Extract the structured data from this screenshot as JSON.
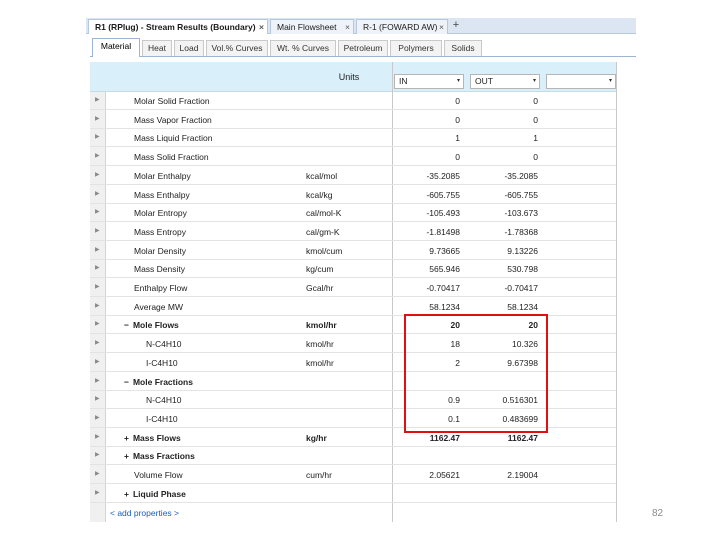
{
  "document_tabs": [
    {
      "label": "R1 (RPlug) - Stream Results (Boundary)",
      "close": "×",
      "active": true
    },
    {
      "label": "Main Flowsheet",
      "close": "×",
      "active": false
    },
    {
      "label": "R-1 (FOWARD AW)",
      "close": "×",
      "active": false
    }
  ],
  "new_tab_label": "+",
  "sub_tabs": [
    "Material",
    "Heat",
    "Load",
    "Vol.% Curves",
    "Wt. % Curves",
    "Petroleum",
    "Polymers",
    "Solids"
  ],
  "active_sub_tab": "Material",
  "grid": {
    "units_header": "Units",
    "stream_columns": [
      {
        "value": "IN",
        "arrow": "▾"
      },
      {
        "value": "OUT",
        "arrow": "▾"
      },
      {
        "value": "",
        "arrow": "▾"
      }
    ],
    "rows": [
      {
        "label": "Molar Solid Fraction",
        "unit": "",
        "in": "0",
        "out": "0"
      },
      {
        "label": "Mass Vapor Fraction",
        "unit": "",
        "in": "0",
        "out": "0"
      },
      {
        "label": "Mass Liquid Fraction",
        "unit": "",
        "in": "1",
        "out": "1"
      },
      {
        "label": "Mass Solid Fraction",
        "unit": "",
        "in": "0",
        "out": "0"
      },
      {
        "label": "Molar Enthalpy",
        "unit": "kcal/mol",
        "in": "-35.2085",
        "out": "-35.2085"
      },
      {
        "label": "Mass Enthalpy",
        "unit": "kcal/kg",
        "in": "-605.755",
        "out": "-605.755"
      },
      {
        "label": "Molar Entropy",
        "unit": "cal/mol-K",
        "in": "-105.493",
        "out": "-103.673"
      },
      {
        "label": "Mass Entropy",
        "unit": "cal/gm-K",
        "in": "-1.81498",
        "out": "-1.78368"
      },
      {
        "label": "Molar Density",
        "unit": "kmol/cum",
        "in": "9.73665",
        "out": "9.13226"
      },
      {
        "label": "Mass Density",
        "unit": "kg/cum",
        "in": "565.946",
        "out": "530.798"
      },
      {
        "label": "Enthalpy Flow",
        "unit": "Gcal/hr",
        "in": "-0.70417",
        "out": "-0.70417"
      },
      {
        "label": "Average MW",
        "unit": "",
        "in": "58.1234",
        "out": "58.1234"
      },
      {
        "label": "Mole Flows",
        "sign": "−",
        "group": true,
        "bold": true,
        "unit": "kmol/hr",
        "in": "20",
        "out": "20"
      },
      {
        "label": "N-C4H10",
        "sub": true,
        "unit": "kmol/hr",
        "in": "18",
        "out": "10.326"
      },
      {
        "label": "I-C4H10",
        "sub": true,
        "unit": "kmol/hr",
        "in": "2",
        "out": "9.67398"
      },
      {
        "label": "Mole Fractions",
        "sign": "−",
        "group": true,
        "unit": "",
        "in": "",
        "out": ""
      },
      {
        "label": "N-C4H10",
        "sub": true,
        "unit": "",
        "in": "0.9",
        "out": "0.516301"
      },
      {
        "label": "I-C4H10",
        "sub": true,
        "unit": "",
        "in": "0.1",
        "out": "0.483699"
      },
      {
        "label": "Mass Flows",
        "sign": "+",
        "group": true,
        "bold": true,
        "unit": "kg/hr",
        "in": "1162.47",
        "out": "1162.47"
      },
      {
        "label": "Mass Fractions",
        "sign": "+",
        "group": true,
        "unit": "",
        "in": "",
        "out": ""
      },
      {
        "label": "Volume Flow",
        "unit": "cum/hr",
        "in": "2.05621",
        "out": "2.19004"
      },
      {
        "label": "Liquid Phase",
        "sign": "+",
        "group": true,
        "unit": "",
        "in": "",
        "out": ""
      }
    ],
    "add_properties": "< add properties >"
  },
  "page_number": "82",
  "colors": {
    "highlight": "#e01010",
    "header_bg": "#d9effa",
    "tab_bg": "#dce6f2"
  }
}
